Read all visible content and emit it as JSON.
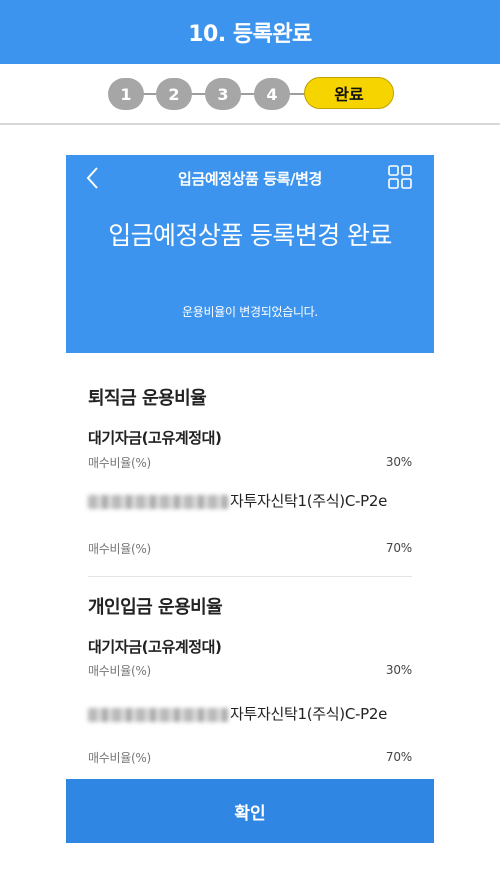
{
  "top_bar": {
    "title": "10. 등록완료"
  },
  "stepper": {
    "steps": [
      "1",
      "2",
      "3",
      "4"
    ],
    "done_label": "완료"
  },
  "phone": {
    "nav": {
      "title": "입금예정상품 등록/변경"
    },
    "icons": {
      "back": "chevron-left-icon",
      "menu": "grid-menu-icon"
    },
    "hero": {
      "title": "입금예정상품 등록변경 완료",
      "subtitle": "운용비율이 변경되었습니다."
    },
    "sections": [
      {
        "title": "퇴직금 운용비율",
        "funds": [
          {
            "name": "대기자금(고유계정대)",
            "ratio_label": "매수비율(%)",
            "ratio": "30%"
          },
          {
            "name": "자투자신탁1(주식)C-P2e",
            "ratio_label": "매수비율(%)",
            "ratio": "70%"
          }
        ]
      },
      {
        "title": "개인입금 운용비율",
        "funds": [
          {
            "name": "대기자금(고유계정대)",
            "ratio_label": "매수비율(%)",
            "ratio": "30%"
          },
          {
            "name": "자투자신탁1(주식)C-P2e",
            "ratio_label": "매수비율(%)",
            "ratio": "70%"
          }
        ]
      }
    ],
    "confirm_label": "확인"
  },
  "colors": {
    "primary": "#3d94ee",
    "button": "#2f87e3",
    "done_badge": "#f6d400",
    "step_inactive": "#a6a6a6"
  }
}
